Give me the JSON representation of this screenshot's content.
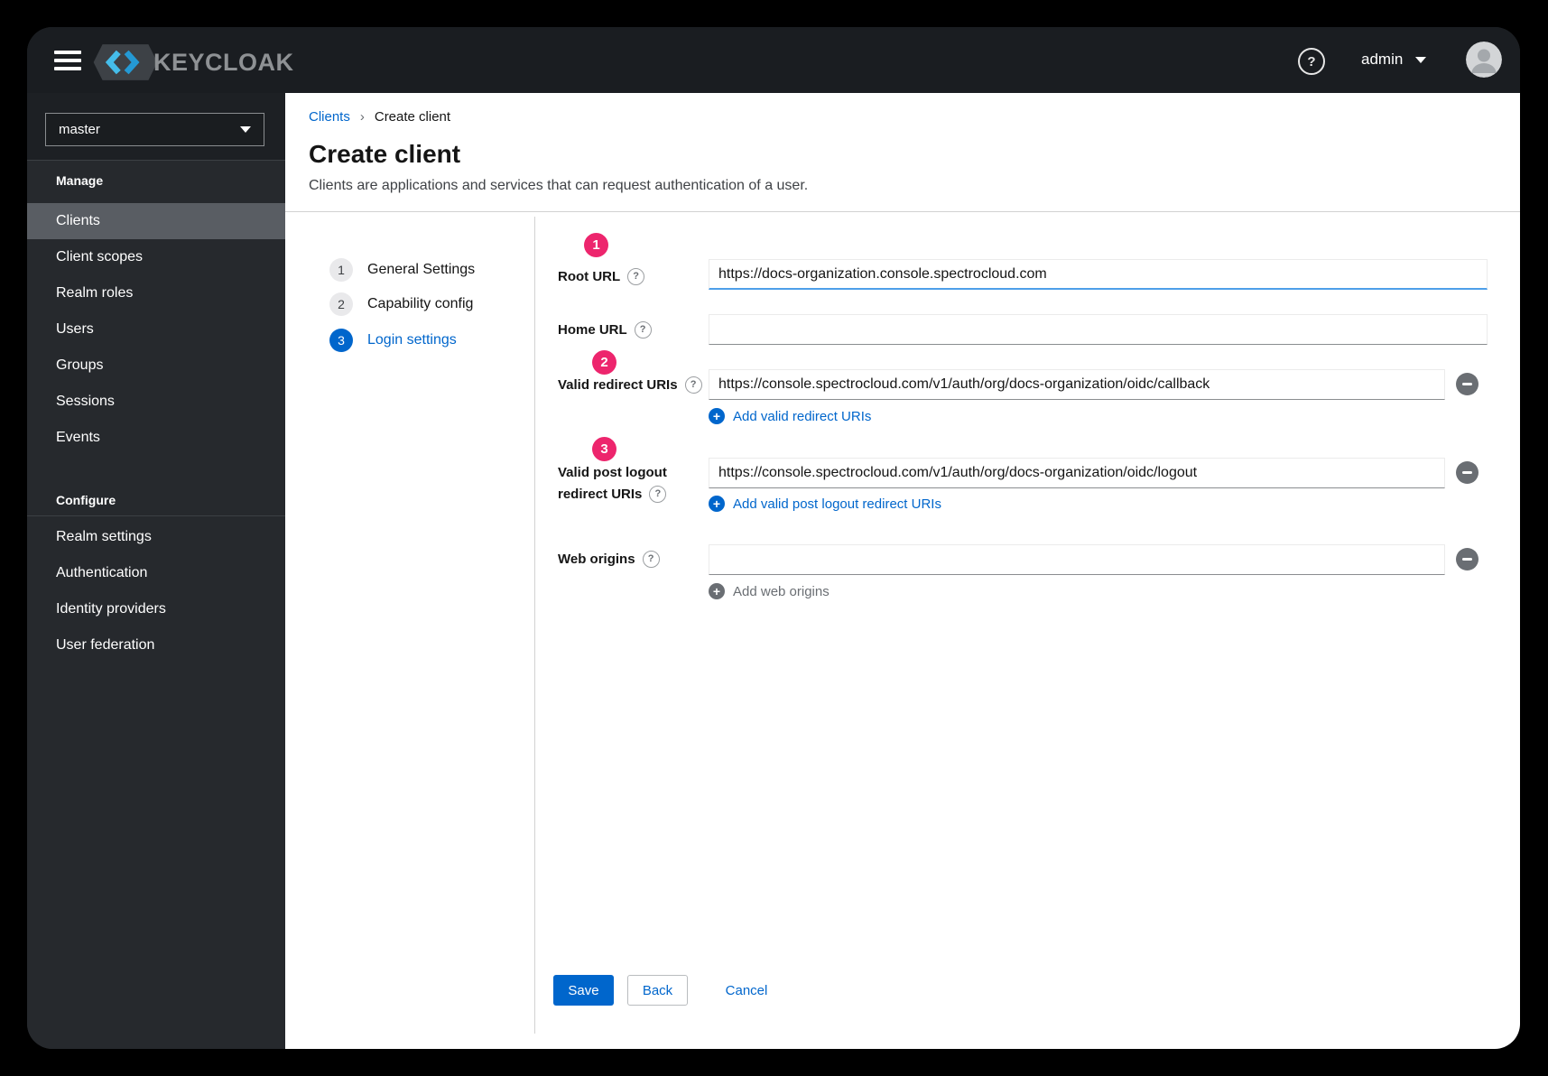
{
  "colors": {
    "accent": "#0066cc",
    "badge": "#ed256d"
  },
  "header": {
    "brand": "KEYCLOAK",
    "username": "admin"
  },
  "sidebar": {
    "realm": "master",
    "sections": [
      {
        "label": "Manage",
        "items": [
          {
            "label": "Clients",
            "active": true
          },
          {
            "label": "Client scopes"
          },
          {
            "label": "Realm roles"
          },
          {
            "label": "Users"
          },
          {
            "label": "Groups"
          },
          {
            "label": "Sessions"
          },
          {
            "label": "Events"
          }
        ]
      },
      {
        "label": "Configure",
        "items": [
          {
            "label": "Realm settings"
          },
          {
            "label": "Authentication"
          },
          {
            "label": "Identity providers"
          },
          {
            "label": "User federation"
          }
        ]
      }
    ]
  },
  "breadcrumb": {
    "parent": "Clients",
    "current": "Create client"
  },
  "page": {
    "title": "Create client",
    "subtitle": "Clients are applications and services that can request authentication of a user."
  },
  "wizard": {
    "steps": [
      {
        "num": "1",
        "label": "General Settings"
      },
      {
        "num": "2",
        "label": "Capability config"
      },
      {
        "num": "3",
        "label": "Login settings",
        "active": true
      }
    ]
  },
  "form": {
    "root_url": {
      "badge": "1",
      "label": "Root URL",
      "value": "https://docs-organization.console.spectrocloud.com"
    },
    "home_url": {
      "label": "Home URL",
      "value": ""
    },
    "valid_redirect_uris": {
      "badge": "2",
      "label": "Valid redirect URIs",
      "value": "https://console.spectrocloud.com/v1/auth/org/docs-organization/oidc/callback",
      "add_label": "Add valid redirect URIs"
    },
    "valid_post_logout": {
      "badge": "3",
      "label_line1": "Valid post logout",
      "label_line2": "redirect URIs",
      "value": "https://console.spectrocloud.com/v1/auth/org/docs-organization/oidc/logout",
      "add_label": "Add valid post logout redirect URIs"
    },
    "web_origins": {
      "label": "Web origins",
      "value": "",
      "add_label": "Add web origins"
    },
    "actions": {
      "save": "Save",
      "back": "Back",
      "cancel": "Cancel"
    }
  }
}
